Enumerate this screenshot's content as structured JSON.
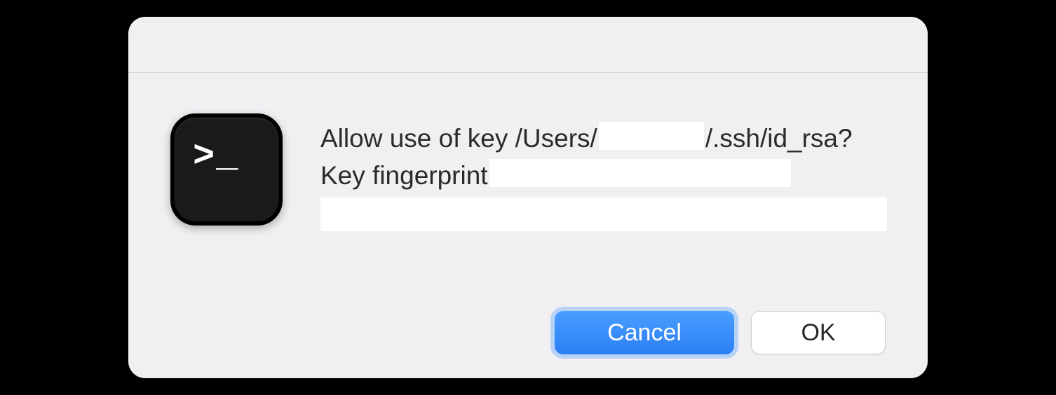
{
  "dialog": {
    "icon": {
      "name": "terminal-icon",
      "prompt_glyph": ">_"
    },
    "message": {
      "line1_prefix": "Allow use of key /Users/",
      "line1_suffix": "/.ssh/id_rsa?",
      "line2_prefix": "Key fingerprint "
    },
    "buttons": {
      "cancel_label": "Cancel",
      "ok_label": "OK"
    }
  }
}
